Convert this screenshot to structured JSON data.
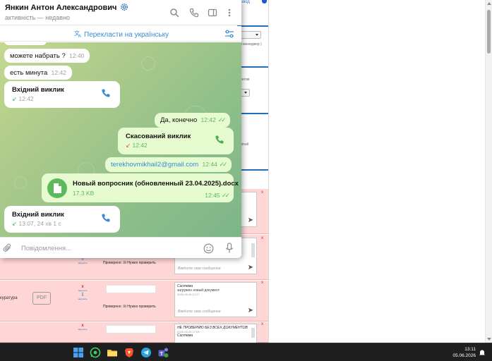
{
  "telegram": {
    "contact_name": "Янкин Антон Александрович",
    "contact_status": "активність — недавно",
    "translate_label": "Перекласти на українську",
    "input_placeholder": "Повідомлення...",
    "messages": [
      {
        "type": "text",
        "direction": "in",
        "text": "можете набрать ?",
        "time": "12:40"
      },
      {
        "type": "text",
        "direction": "in",
        "text": "есть минута",
        "time": "12:42"
      },
      {
        "type": "call",
        "direction": "in",
        "title": "Вхідний виклик",
        "meta": "12:42"
      },
      {
        "type": "text",
        "direction": "out",
        "text": "Да, конечно",
        "time": "12:42"
      },
      {
        "type": "call",
        "direction": "out",
        "title": "Скасований виклик",
        "meta": "12:42"
      },
      {
        "type": "text",
        "direction": "out",
        "text": "terekhovmikhail2@gmail.com",
        "time": "12:44"
      },
      {
        "type": "file",
        "direction": "out",
        "name": "Новый вопросник (обновленный 23.04.2025).docx",
        "size": "17.3 KB",
        "time": "12:45"
      },
      {
        "type": "call",
        "direction": "in",
        "title": "Вхідний виклик",
        "meta": "13:07, 24 хв 1 с"
      }
    ]
  },
  "background": {
    "top_link": "нзвод",
    "card_text_1": "й менеджер )",
    "card_text_2": "ентов",
    "card_text_3": "gmail",
    "rows": [
      {
        "side": "",
        "checked": "Проверено",
        "needs": "Нужно проверить",
        "chat_header": "",
        "chat_sub": "",
        "chat_date": "",
        "placeholder": ""
      },
      {
        "side": "",
        "checked": "Проверено",
        "needs": "Нужно проверить",
        "chat_header": "",
        "chat_sub": "",
        "chat_date": "",
        "placeholder": "Введите свое сообщение"
      },
      {
        "side": "куратура",
        "pdf": "PDF",
        "checked": "Проверено",
        "needs": "Нужно проверить",
        "chat_header": "Система",
        "chat_sub": "загружен новый документ",
        "chat_date": "2026-06-05 12:37",
        "placeholder": "Введите свое сообщение"
      },
      {
        "side": "",
        "checked": "",
        "needs": "",
        "chat_header": "НЕ ПРОВЕРЯЮ БЕЗ ВСЕХ ДОКУМЕНТОВ",
        "chat_sub": "Система",
        "chat_date": "2026-06-05 17:08",
        "placeholder": ""
      }
    ],
    "action_label": "загрузить",
    "close": "x"
  },
  "taskbar": {
    "time": "13:11",
    "date": "05.06.2026",
    "icons": [
      "windows-start-icon",
      "whatsapp-icon",
      "file-explorer-icon",
      "brave-icon",
      "telegram-icon",
      "teams-icon"
    ]
  },
  "colors": {
    "telegram_accent": "#3a8bd6",
    "outgoing_bubble": "#e6fbcf",
    "row_highlight": "#ffd6d6",
    "taskbar": "#1f1f1f"
  }
}
